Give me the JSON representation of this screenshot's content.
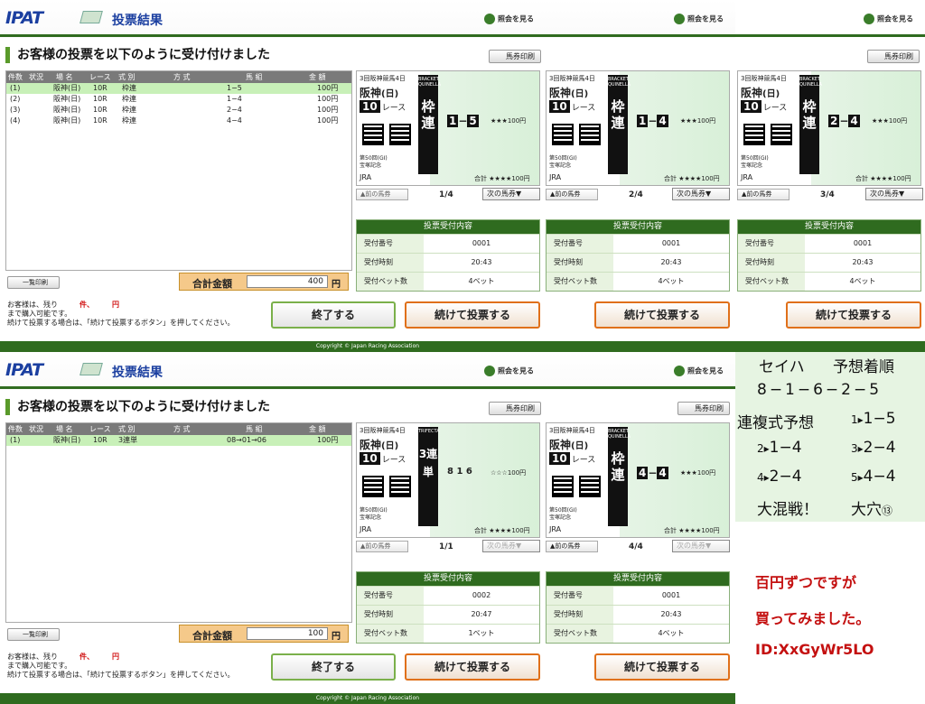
{
  "common": {
    "logo": "IPAT",
    "title": "投票結果",
    "shokai": "照会を見る",
    "heading": "お客様の投票を以下のように受け付けました",
    "print_ticket": "馬券印刷",
    "print_list": "一覧印刷",
    "total_label": "合計金額",
    "yen": "円",
    "end_label": "終了する",
    "continue_label": "続けて投票する",
    "copyright": "Copyright © Japan Racing Association",
    "note_line1": "お客様は、残り",
    "note_ken": "件、",
    "note_en": "円",
    "note_line2": "まで購入可能です。",
    "note_line3": "続けて投票する場合は、「続けて投票するボタン」を押してください。",
    "prev": "前の馬券",
    "next": "次の馬券",
    "info_title": "投票受付内容",
    "k_no": "受付番号",
    "k_time": "受付時刻",
    "k_bets": "受付ベット数",
    "t_top": "3回阪神競馬4日",
    "t_venue": "阪神",
    "t_day": "(日)",
    "t_racenum": "10",
    "t_race": "レース",
    "t_name1": "第50回(GI)",
    "t_name2": "宝塚記念",
    "t_jra": "JRA",
    "t_sum": "合計 ★★★★100円",
    "star": "★★★100円",
    "star3": "☆☆☆100円",
    "bracket": "BRACKET QUINELLA",
    "trifecta": "TRIFECTA",
    "wakuren": "枠連",
    "sanrentan": "3連単"
  },
  "headers": [
    "件数",
    "状況",
    "場 名",
    "レース",
    "式 別",
    "方 式",
    "馬 組",
    "金 額"
  ],
  "screen1": {
    "total": "400",
    "rows": [
      [
        "(1)",
        "阪神(日)",
        "10R",
        "枠連",
        "1−5",
        "100円"
      ],
      [
        "(2)",
        "阪神(日)",
        "10R",
        "枠連",
        "1−4",
        "100円"
      ],
      [
        "(3)",
        "阪神(日)",
        "10R",
        "枠連",
        "2−4",
        "100円"
      ],
      [
        "(4)",
        "阪神(日)",
        "10R",
        "枠連",
        "4−4",
        "100円"
      ]
    ],
    "tickets": [
      {
        "c1": "1",
        "c2": "5",
        "page": "1/4",
        "no": "0001",
        "time": "20:43",
        "bets": "4ベット"
      },
      {
        "c1": "1",
        "c2": "4",
        "page": "2/4",
        "no": "0001",
        "time": "20:43",
        "bets": "4ベット"
      },
      {
        "c1": "2",
        "c2": "4",
        "page": "3/4",
        "no": "0001",
        "time": "20:43",
        "bets": "4ベット"
      }
    ]
  },
  "screen2": {
    "total": "100",
    "rows": [
      [
        "(1)",
        "阪神(日)",
        "10R",
        "3連単",
        "08→01→06",
        "100円"
      ]
    ],
    "tickets": [
      {
        "combo": "8 1 6",
        "page": "1/1",
        "no": "0002",
        "time": "20:47",
        "bets": "1ベット"
      },
      {
        "c1": "4",
        "c2": "4",
        "page": "4/4",
        "no": "0001",
        "time": "20:43",
        "bets": "4ベット"
      }
    ]
  },
  "side": {
    "l1a": "セイハ",
    "l1b": "予想着順",
    "l2": "8−1−6−2−5",
    "l3a": "連複式予想",
    "l3b": "1−5",
    "l4a": "1−4",
    "l4b": "2−4",
    "l5a": "2−4",
    "l5b": "4−4",
    "l6a": "大混戦！",
    "l6b": "大穴",
    "m1": "百円ずつですが",
    "m2": "買ってみました。",
    "m3": "ID:XxGyWr5LO"
  }
}
